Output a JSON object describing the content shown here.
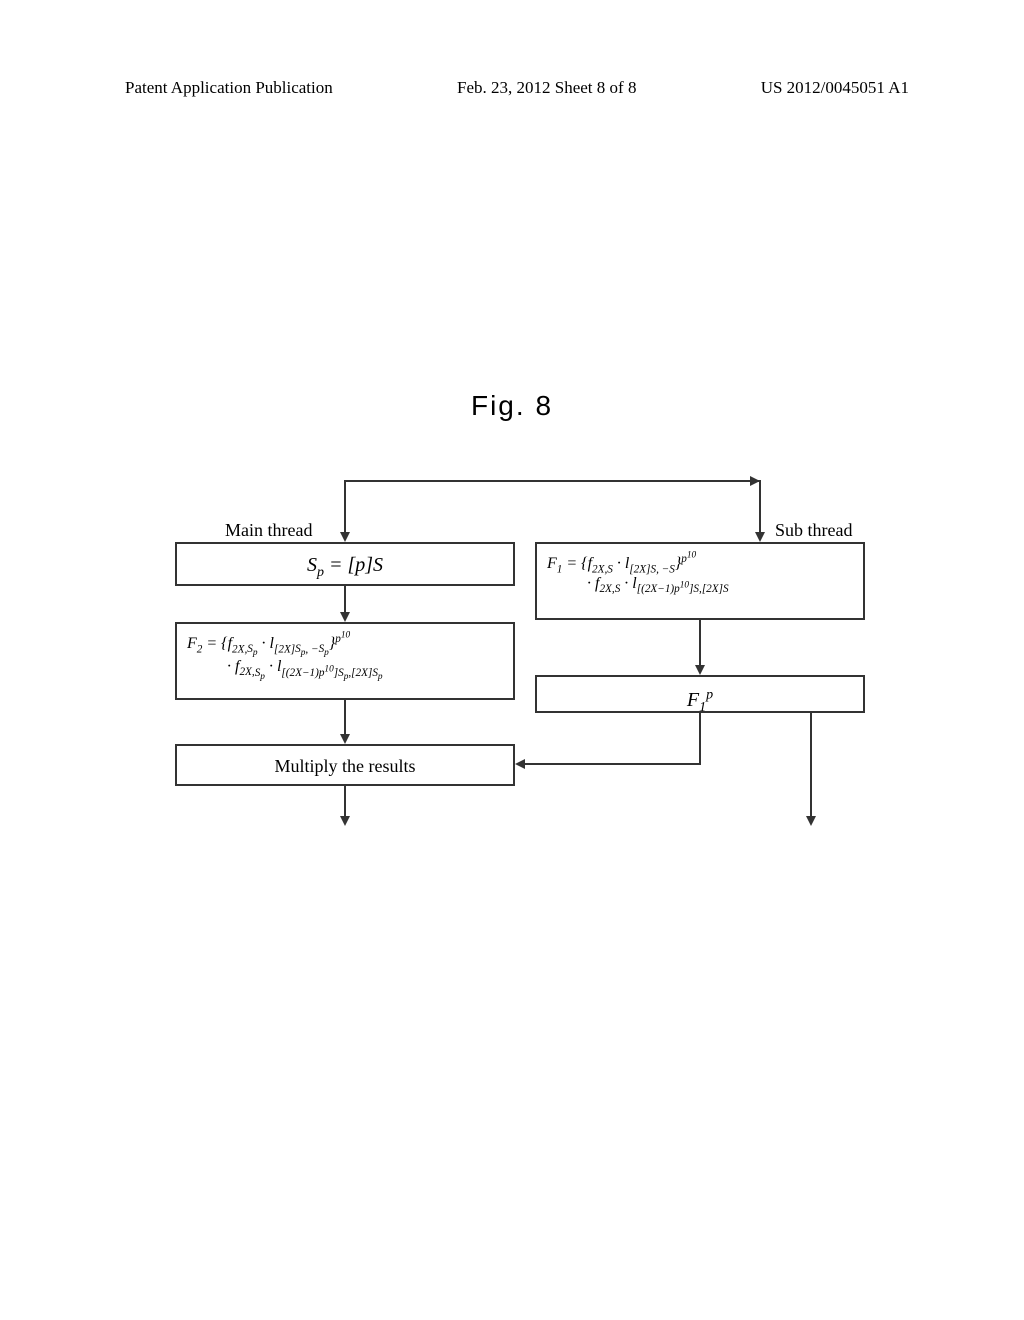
{
  "header": {
    "left": "Patent Application Publication",
    "center": "Feb. 23, 2012  Sheet 8 of 8",
    "right": "US 2012/0045051 A1"
  },
  "figure_label": "Fig. 8",
  "labels": {
    "main_thread": "Main thread",
    "sub_thread": "Sub thread"
  },
  "boxes": {
    "sp": "S_p = [p]S",
    "f1_line1": "F₁ = {f₂ₓ,S · l[2X]S, −S}^p¹⁰",
    "f1_line2": "· f₂ₓ,S · l[(2X−1)p¹⁰]S,[2X]S",
    "f2_line1": "F₂ = {f₂ₓ,Sₚ · l[2X]Sₚ, −Sₚ}^p¹⁰",
    "f2_line2": "· f₂ₓ,Sₚ · l[(2X−1)p¹⁰]Sₚ,[2X]Sₚ",
    "f1p": "F₁^p",
    "multiply": "Multiply the results"
  }
}
